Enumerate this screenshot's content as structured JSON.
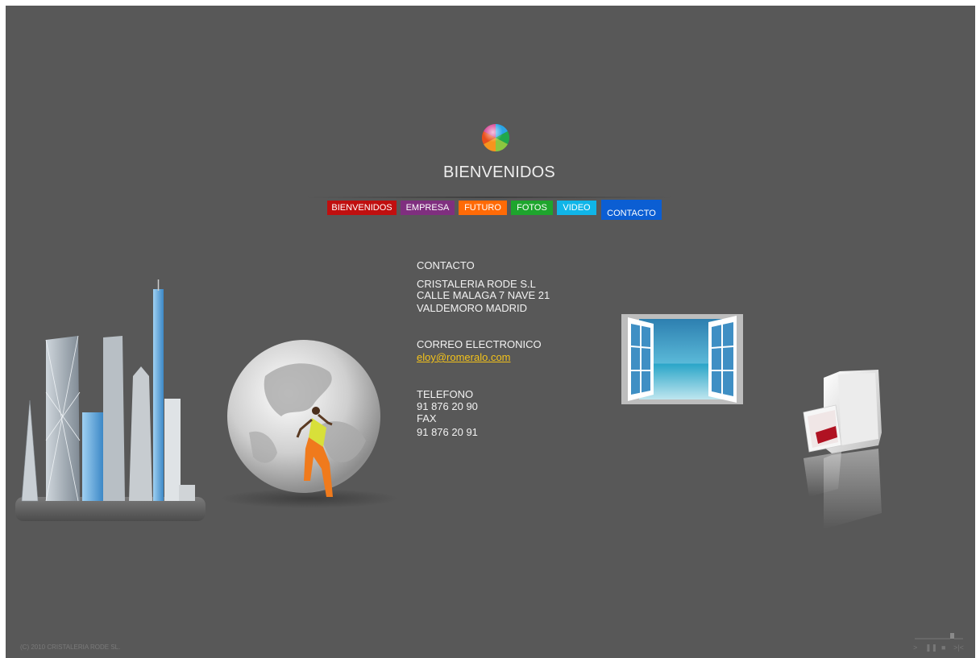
{
  "header": {
    "title": "BIENVENIDOS",
    "logo_icon": "color-wheel-logo"
  },
  "nav": {
    "items": [
      {
        "label": "BIENVENIDOS",
        "color": "#c00f0f"
      },
      {
        "label": "EMPRESA",
        "color": "#7f2f7f"
      },
      {
        "label": "FUTURO",
        "color": "#ff6a06"
      },
      {
        "label": "FOTOS",
        "color": "#1ea52d"
      },
      {
        "label": "VIDEO",
        "color": "#10b5e8"
      },
      {
        "label": "CONTACTO",
        "color": "#0b5ed3"
      }
    ]
  },
  "contact": {
    "heading": "CONTACTO",
    "company": [
      "CRISTALERIA RODE S.L",
      "CALLE MALAGA 7 NAVE 21",
      "VALDEMORO MADRID"
    ],
    "email_heading": "CORREO ELECTRONICO",
    "email": "eloy@romeralo.com",
    "phone_heading": "TELEFONO",
    "phone": "91 876 20 90",
    "fax_heading": "FAX",
    "fax": "91 876 20 91"
  },
  "images": {
    "skyscrapers": "skyscrapers-image",
    "globe": "globe-with-person-image",
    "window": "open-window-beach-image",
    "folder": "folder-with-documents-icon"
  },
  "footer": {
    "copyright": "(C) 2010 CRISTALERIA RODE SL."
  },
  "player": {
    "play": "play-icon",
    "pause": "pause-icon",
    "stop": "stop-icon",
    "next": "next-icon",
    "volume": "volume-icon"
  },
  "colors": {
    "background": "#585858",
    "link": "#f3c21a"
  }
}
